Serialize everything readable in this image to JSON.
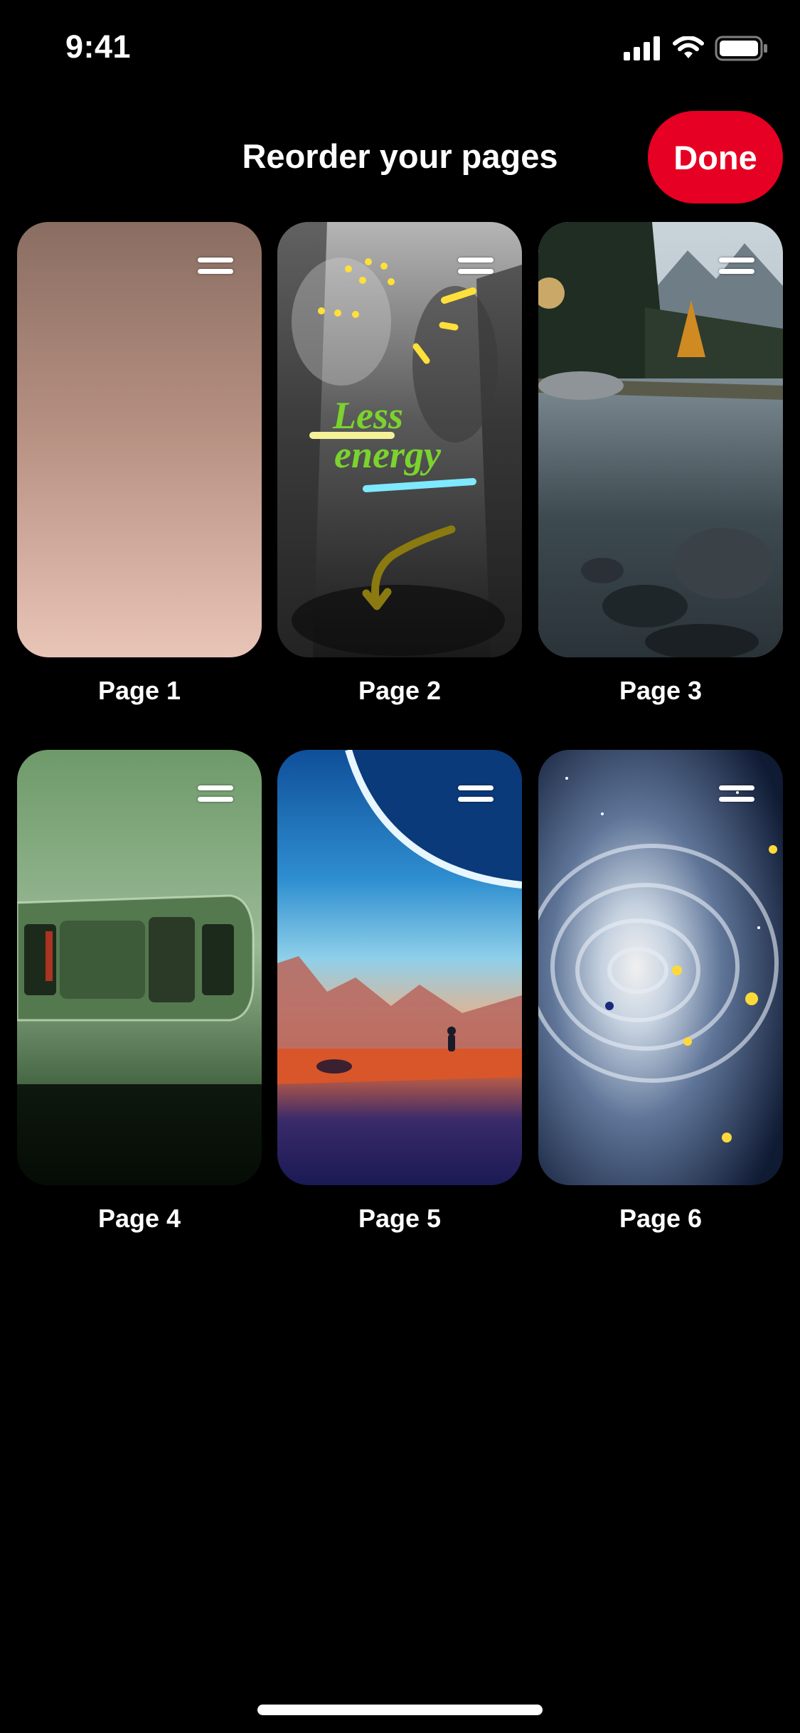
{
  "status_bar": {
    "time": "9:41",
    "icons": [
      "cellular-signal-icon",
      "wifi-icon",
      "battery-icon"
    ]
  },
  "header": {
    "title": "Reorder your pages",
    "done_label": "Done"
  },
  "pages": [
    {
      "label": "Page 1"
    },
    {
      "label": "Page 2",
      "overlay_text_line1": "Less",
      "overlay_text_line2": "energy"
    },
    {
      "label": "Page 3"
    },
    {
      "label": "Page 4"
    },
    {
      "label": "Page 5"
    },
    {
      "label": "Page 6"
    }
  ],
  "colors": {
    "accent": "#e60023",
    "background": "#000000",
    "text": "#ffffff"
  }
}
